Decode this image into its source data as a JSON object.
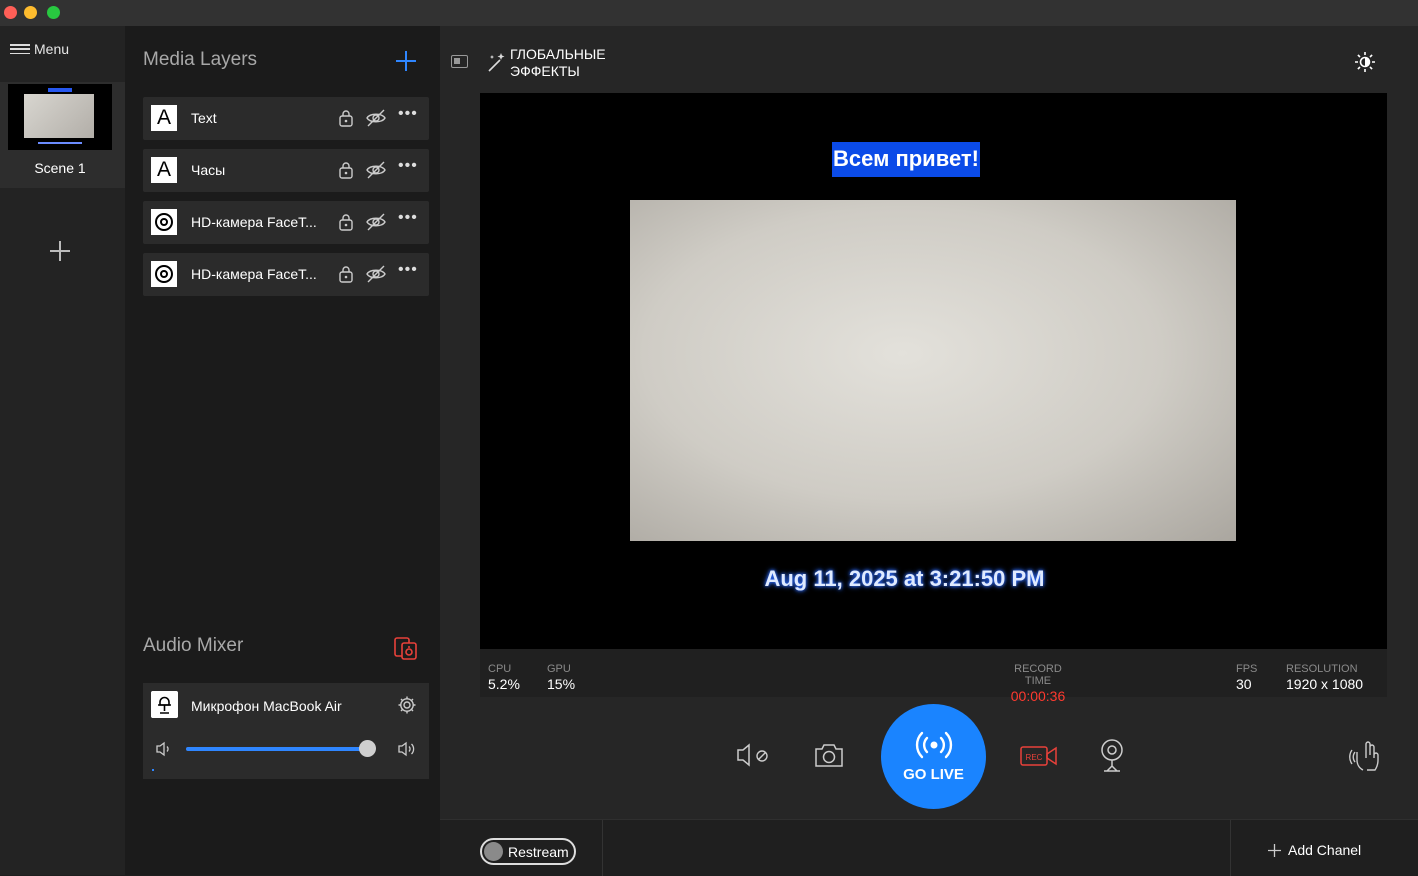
{
  "window": {
    "controls": [
      "close",
      "minimize",
      "zoom"
    ]
  },
  "scenes": {
    "menu_label": "Menu",
    "items": [
      {
        "name": "Scene 1"
      }
    ]
  },
  "layers_panel": {
    "title": "Media Layers",
    "layers": [
      {
        "icon": "text-layer-icon",
        "icon_glyph": "A",
        "name": "Text"
      },
      {
        "icon": "text-layer-icon",
        "icon_glyph": "A",
        "name": "Часы"
      },
      {
        "icon": "camera-layer-icon",
        "name": "HD-камера FaceT..."
      },
      {
        "icon": "camera-layer-icon",
        "name": "HD-камера FaceT..."
      }
    ]
  },
  "audio_mixer": {
    "title": "Audio Mixer",
    "source": {
      "name": "Микрофон MacBook Air",
      "volume": 1.0
    }
  },
  "toolbar": {
    "effects_label": "ГЛОБАЛЬНЫЕ ЭФФЕКТЫ"
  },
  "preview": {
    "greeting_text": "Всем привет!",
    "clock_text": "Aug 11, 2025 at 3:21:50 PM"
  },
  "stats": {
    "cpu_label": "CPU",
    "cpu_value": "5.2%",
    "gpu_label": "GPU",
    "gpu_value": "15%",
    "record_label": "RECORD TIME",
    "record_value": "00:00:36",
    "fps_label": "FPS",
    "fps_value": "30",
    "resolution_label": "RESOLUTION",
    "resolution_value": "1920 x 1080"
  },
  "controls": {
    "go_live_label": "GO LIVE",
    "rec_label": "REC"
  },
  "bottom": {
    "restream_label": "Restream",
    "add_channel_label": "Add Chanel"
  },
  "colors": {
    "accent": "#1a84ff",
    "record_red": "#ff3a2f",
    "greeting_bg": "#0b4be8"
  }
}
